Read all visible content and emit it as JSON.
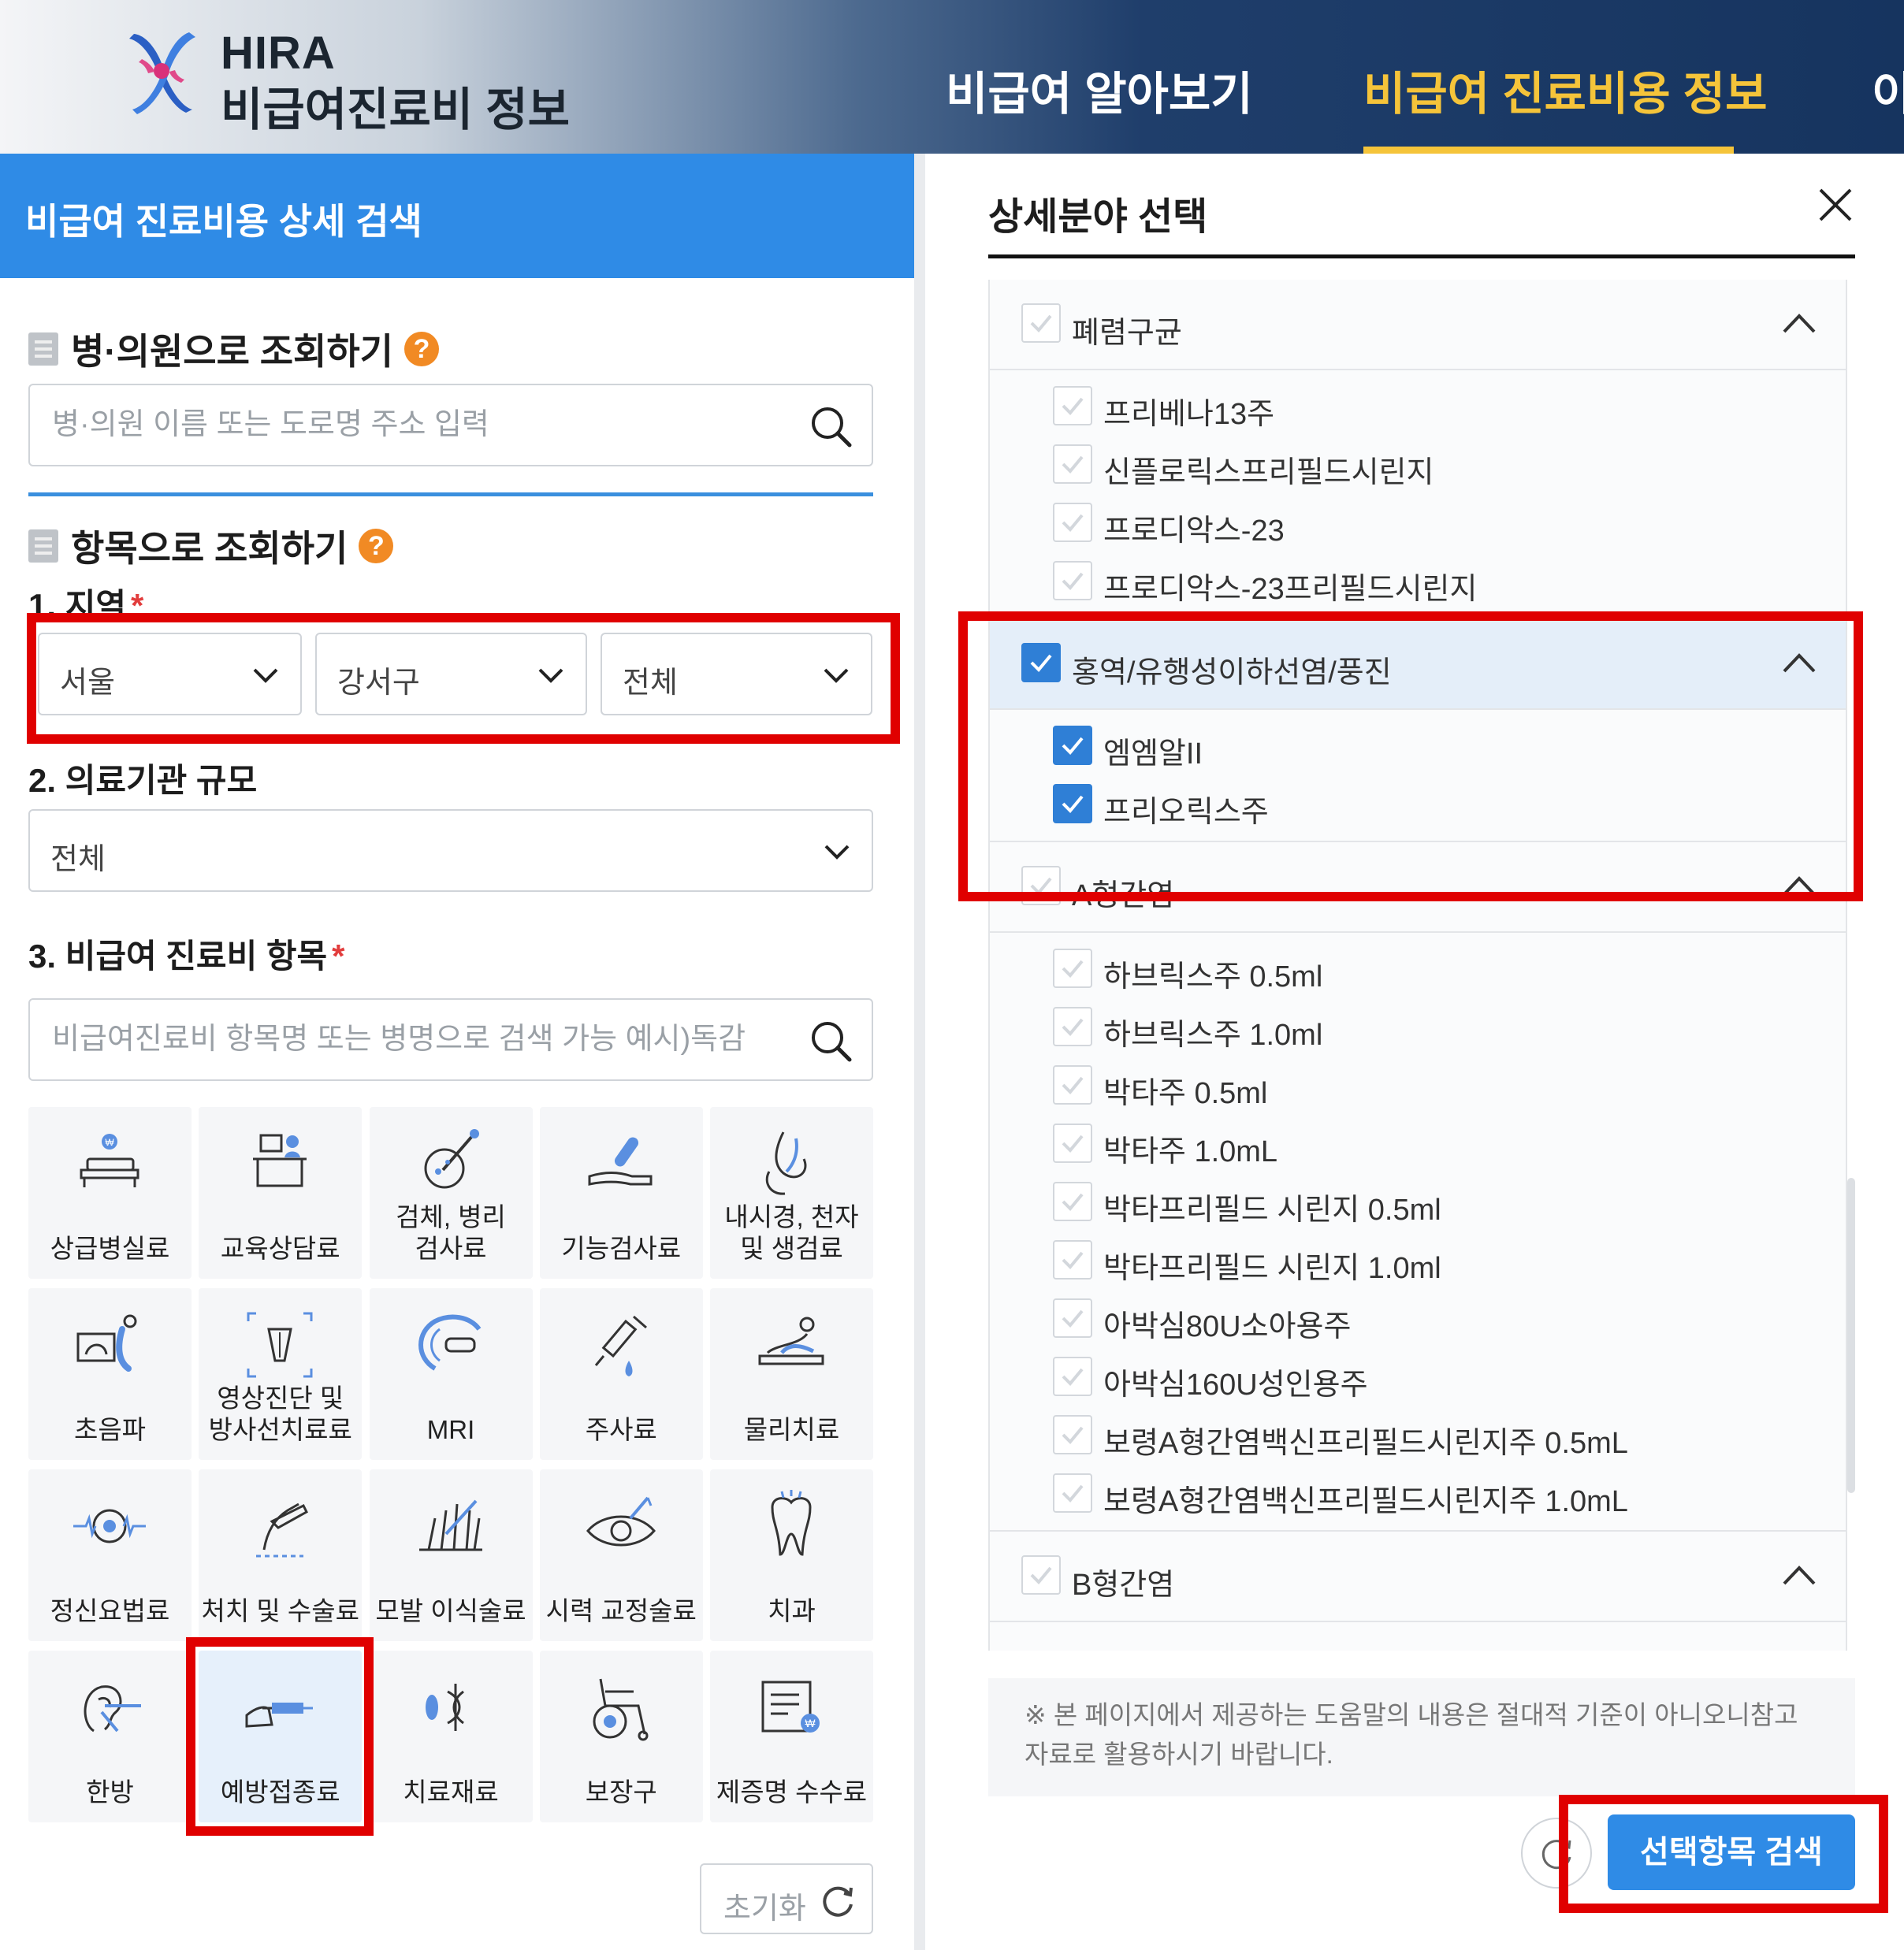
{
  "header": {
    "brand_line1": "HIRA",
    "brand_line2": "비급여진료비 정보",
    "nav": [
      "비급여 알아보기",
      "비급여 진료비용 정보",
      "이"
    ],
    "active_nav_index": 1,
    "colors": {
      "active": "#f5c43a",
      "bar_dark": "#16345f"
    }
  },
  "left": {
    "title": "비급여 진료비용 상세 검색",
    "by_hospital": {
      "heading": "병·의원으로 조회하기",
      "help": "?",
      "placeholder": "병·의원 이름 또는 도로명 주소 입력",
      "value": ""
    },
    "by_item": {
      "heading": "항목으로 조회하기",
      "help": "?"
    },
    "region": {
      "label": "1. 지역",
      "required": "*",
      "sido": "서울",
      "sigungu": "강서구",
      "dong": "전체"
    },
    "scale": {
      "label": "2. 의료기관 규모",
      "value": "전체"
    },
    "category": {
      "label": "3. 비급여 진료비 항목",
      "required": "*",
      "placeholder": "비급여진료비 항목명 또는 병명으로 검색 가능 예시)독감",
      "value": ""
    },
    "tiles": [
      {
        "label": "상급병실료",
        "icon": "hospital-bed-icon"
      },
      {
        "label": "교육상담료",
        "icon": "consultation-icon"
      },
      {
        "label": "검체, 병리\n검사료",
        "icon": "pathology-icon"
      },
      {
        "label": "기능검사료",
        "icon": "function-test-icon"
      },
      {
        "label": "내시경, 천자\n및 생검료",
        "icon": "endoscope-icon"
      },
      {
        "label": "초음파",
        "icon": "ultrasound-icon"
      },
      {
        "label": "영상진단 및\n방사선치료료",
        "icon": "radiology-icon"
      },
      {
        "label": "MRI",
        "icon": "mri-icon"
      },
      {
        "label": "주사료",
        "icon": "syringe-icon"
      },
      {
        "label": "물리치료",
        "icon": "physical-therapy-icon"
      },
      {
        "label": "정신요법료",
        "icon": "brain-wave-icon"
      },
      {
        "label": "처치 및 수술료",
        "icon": "surgery-icon"
      },
      {
        "label": "모발 이식술료",
        "icon": "hair-transplant-icon"
      },
      {
        "label": "시력 교정술료",
        "icon": "eye-icon"
      },
      {
        "label": "치과",
        "icon": "tooth-icon"
      },
      {
        "label": "한방",
        "icon": "acupuncture-icon"
      },
      {
        "label": "예방접종료",
        "icon": "vaccination-icon"
      },
      {
        "label": "치료재료",
        "icon": "treatment-material-icon"
      },
      {
        "label": "보장구",
        "icon": "wheelchair-icon"
      },
      {
        "label": "제증명 수수료",
        "icon": "certificate-icon"
      }
    ],
    "selected_tile_index": 16,
    "reset_label": "초기화"
  },
  "right": {
    "title": "상세분야 선택",
    "groups": [
      {
        "label": "폐렴구균",
        "checked": false,
        "expanded": true,
        "items": [
          {
            "label": "프리베나13주",
            "checked": false
          },
          {
            "label": "신플로릭스프리필드시린지",
            "checked": false
          },
          {
            "label": "프로디악스-23",
            "checked": false
          },
          {
            "label": "프로디악스-23프리필드시린지",
            "checked": false
          }
        ]
      },
      {
        "label": "홍역/유행성이하선염/풍진",
        "checked": true,
        "expanded": true,
        "items": [
          {
            "label": "엠엠알II",
            "checked": true
          },
          {
            "label": "프리오릭스주",
            "checked": true
          }
        ]
      },
      {
        "label": "A형간염",
        "checked": false,
        "expanded": true,
        "items": [
          {
            "label": "하브릭스주 0.5ml",
            "checked": false
          },
          {
            "label": "하브릭스주 1.0ml",
            "checked": false
          },
          {
            "label": "박타주 0.5ml",
            "checked": false
          },
          {
            "label": "박타주 1.0mL",
            "checked": false
          },
          {
            "label": "박타프리필드 시린지 0.5ml",
            "checked": false
          },
          {
            "label": "박타프리필드 시린지 1.0ml",
            "checked": false
          },
          {
            "label": "아박심80U소아용주",
            "checked": false
          },
          {
            "label": "아박심160U성인용주",
            "checked": false
          },
          {
            "label": "보령A형간염백신프리필드시린지주 0.5mL",
            "checked": false
          },
          {
            "label": "보령A형간염백신프리필드시린지주 1.0mL",
            "checked": false
          }
        ]
      },
      {
        "label": "B형간염",
        "checked": false,
        "expanded": true,
        "items": []
      }
    ],
    "note": "※ 본 페이지에서 제공하는 도움말의 내용은 절대적 기준이 아니오니참고자료로 활용하시기 바랍니다.",
    "search_button": "선택항목 검색"
  },
  "colors": {
    "primary_blue": "#2f8be6",
    "help_orange": "#f18a24",
    "highlight_red": "#e00000",
    "checkbox_on": "#2f7fd6"
  }
}
